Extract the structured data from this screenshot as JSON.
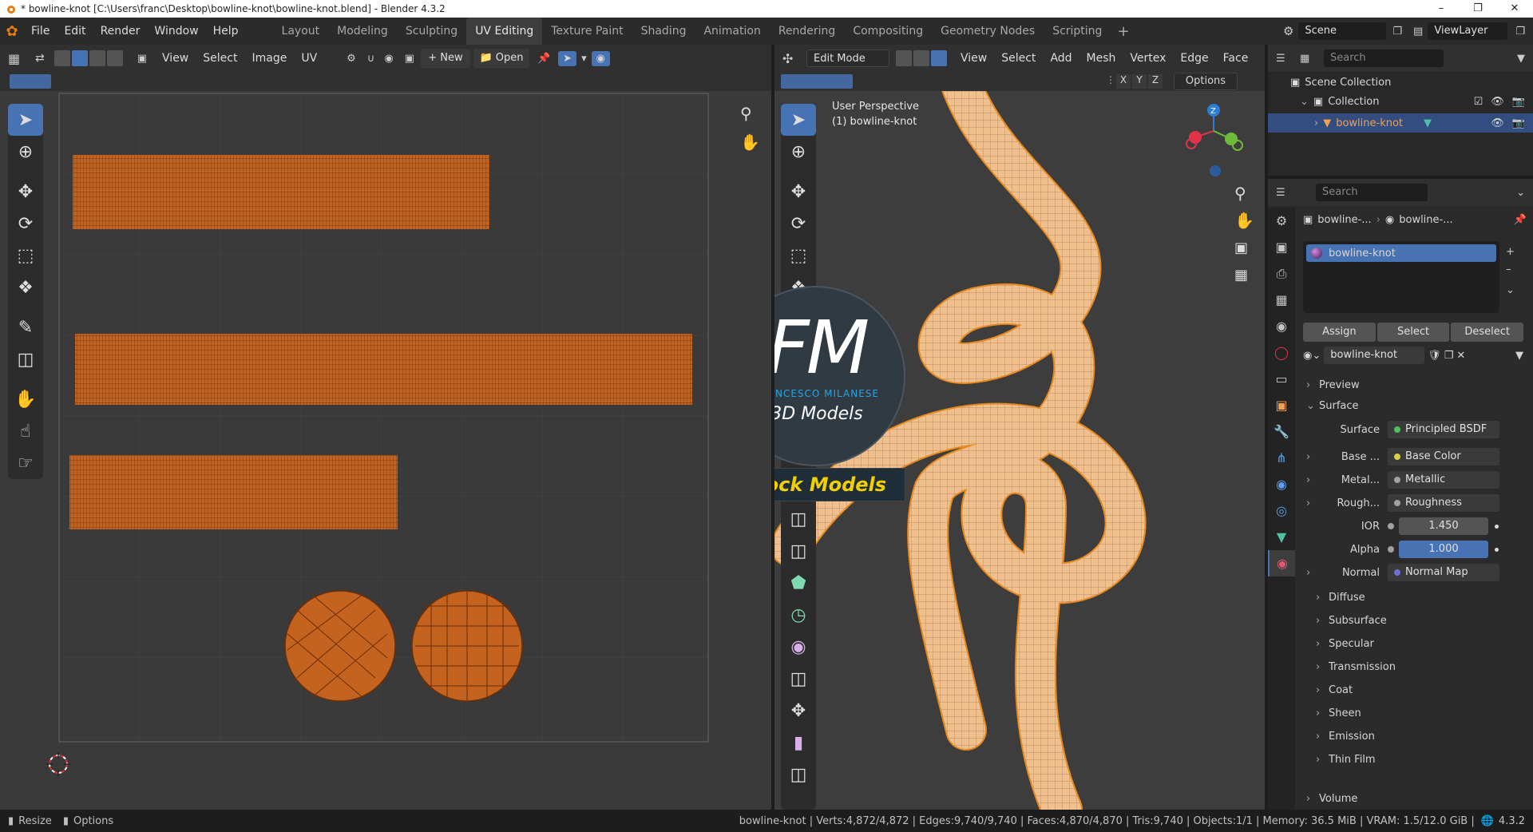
{
  "window": {
    "title": "* bowline-knot [C:\\Users\\franc\\Desktop\\bowline-knot\\bowline-knot.blend] - Blender 4.3.2"
  },
  "menu": [
    "File",
    "Edit",
    "Render",
    "Window",
    "Help"
  ],
  "workspaces": [
    "Layout",
    "Modeling",
    "Sculpting",
    "UV Editing",
    "Texture Paint",
    "Shading",
    "Animation",
    "Rendering",
    "Compositing",
    "Geometry Nodes",
    "Scripting"
  ],
  "active_workspace": "UV Editing",
  "scene": {
    "scene_name": "Scene",
    "view_layer": "ViewLayer"
  },
  "uv_editor": {
    "menus": [
      "View",
      "Select",
      "Image",
      "UV"
    ],
    "new_label": "New",
    "open_label": "Open"
  },
  "viewport": {
    "mode": "Edit Mode",
    "menus": [
      "View",
      "Select",
      "Add",
      "Mesh",
      "Vertex",
      "Edge",
      "Face"
    ],
    "axes": [
      "X",
      "Y",
      "Z"
    ],
    "options_label": "Options",
    "overlay_line1": "User Perspective",
    "overlay_line2": "(1) bowline-knot",
    "gizmo_z": "Z"
  },
  "watermark": {
    "monogram": "FM",
    "name": "FRANCESCO MILANESE",
    "sub": "3D Models",
    "banner": "Stock Models"
  },
  "outliner": {
    "search_placeholder": "Search",
    "root": "Scene Collection",
    "collection": "Collection",
    "object": "bowline-knot"
  },
  "properties": {
    "search_placeholder": "Search",
    "breadcrumb_object": "bowline-...",
    "breadcrumb_material": "bowline-...",
    "material_slot": "bowline-knot",
    "assign": "Assign",
    "select": "Select",
    "deselect": "Deselect",
    "material_name": "bowline-knot",
    "preview_label": "Preview",
    "surface_label": "Surface",
    "surface_key": "Surface",
    "surface_value": "Principled BSDF",
    "base_color_key": "Base ...",
    "base_color_value": "Base Color",
    "metallic_key": "Metal...",
    "metallic_value": "Metallic",
    "roughness_key": "Rough...",
    "roughness_value": "Roughness",
    "ior_key": "IOR",
    "ior_value": "1.450",
    "alpha_key": "Alpha",
    "alpha_value": "1.000",
    "normal_key": "Normal",
    "normal_value": "Normal Map",
    "subpanels": [
      "Diffuse",
      "Subsurface",
      "Specular",
      "Transmission",
      "Coat",
      "Sheen",
      "Emission",
      "Thin Film"
    ],
    "volume_label": "Volume"
  },
  "status": {
    "resize": "Resize",
    "options": "Options",
    "stats": "bowline-knot | Verts:4,872/4,872 | Edges:9,740/9,740 | Faces:4,870/4,870 | Tris:9,740 | Objects:1/1 | Memory: 36.5 MiB | VRAM: 1.5/12.0 GiB |",
    "version": "4.3.2"
  },
  "colors": {
    "accent": "#4772b3",
    "uv_island": "#c4621f",
    "knot": "#f0c290",
    "brand_blue": "#2ba3e0"
  }
}
